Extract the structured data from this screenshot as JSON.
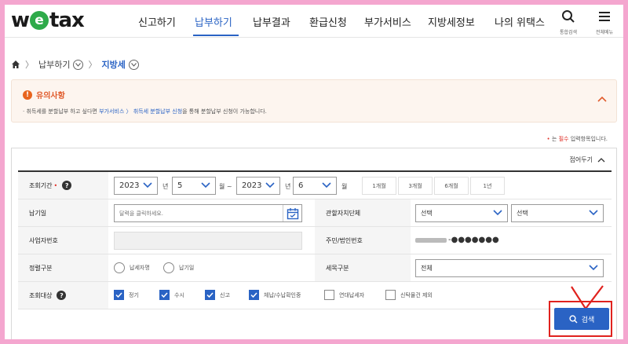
{
  "logo": {
    "left": "w",
    "middle": "e",
    "right": "tax"
  },
  "gnb": {
    "items": [
      "신고하기",
      "납부하기",
      "납부결과",
      "환급신청",
      "부가서비스",
      "지방세정보",
      "나의 위택스"
    ],
    "active_index": 1,
    "search_label": "통합검색",
    "menu_label": "전체메뉴"
  },
  "breadcrumb": {
    "level1": "납부하기",
    "level2": "지방세"
  },
  "notice": {
    "title": "유의사항",
    "text_before": "· 취득세를 분할납부 하고 싶다면 ",
    "text_link1": "부가서비스 〉 취득세 분할납부 신청",
    "text_after": "을 통해 분할납부 신청이 가능합니다."
  },
  "required_note": {
    "prefix": "• 는 ",
    "red": "필수",
    "suffix": " 입력항목입니다."
  },
  "panel": {
    "fold_label": "접어두기"
  },
  "form": {
    "period": {
      "label": "조회기간",
      "required_mark": "•",
      "help_icon": "?",
      "from_year": "2023",
      "from_month": "5",
      "to_year": "2023",
      "to_month": "6",
      "unit_year": "년",
      "unit_month_tilde": "월 ~",
      "unit_month": "월",
      "quick": [
        "1개월",
        "3개월",
        "6개월",
        "1년"
      ]
    },
    "due_date": {
      "label": "납기일",
      "placeholder": "달력을 클릭하세요."
    },
    "jurisdiction": {
      "label": "관할자치단체",
      "select1": "선택",
      "select2": "선택"
    },
    "business_no": {
      "label": "사업자번호",
      "value": ""
    },
    "resident_no": {
      "label": "주민/법인번호",
      "masked_suffix": "-●●●●●●●"
    },
    "sort": {
      "label": "정렬구분",
      "options": [
        "납세자명",
        "납기일"
      ]
    },
    "tax_item": {
      "label": "세목구분",
      "value": "전체"
    },
    "target": {
      "label": "조회대상",
      "help_icon": "?",
      "checks": [
        {
          "label": "정기",
          "checked": true
        },
        {
          "label": "수시",
          "checked": true
        },
        {
          "label": "신고",
          "checked": true
        },
        {
          "label": "체납/수납확인중",
          "checked": true
        },
        {
          "label": "연대납세자",
          "checked": false
        },
        {
          "label": "신탁물건 제외",
          "checked": false
        }
      ]
    }
  },
  "search_button": {
    "label": "검색"
  },
  "colors": {
    "accent": "#2a63c4",
    "warning": "#e8641e",
    "frame": "#f4a6cf",
    "annotation": "#e0221e"
  }
}
